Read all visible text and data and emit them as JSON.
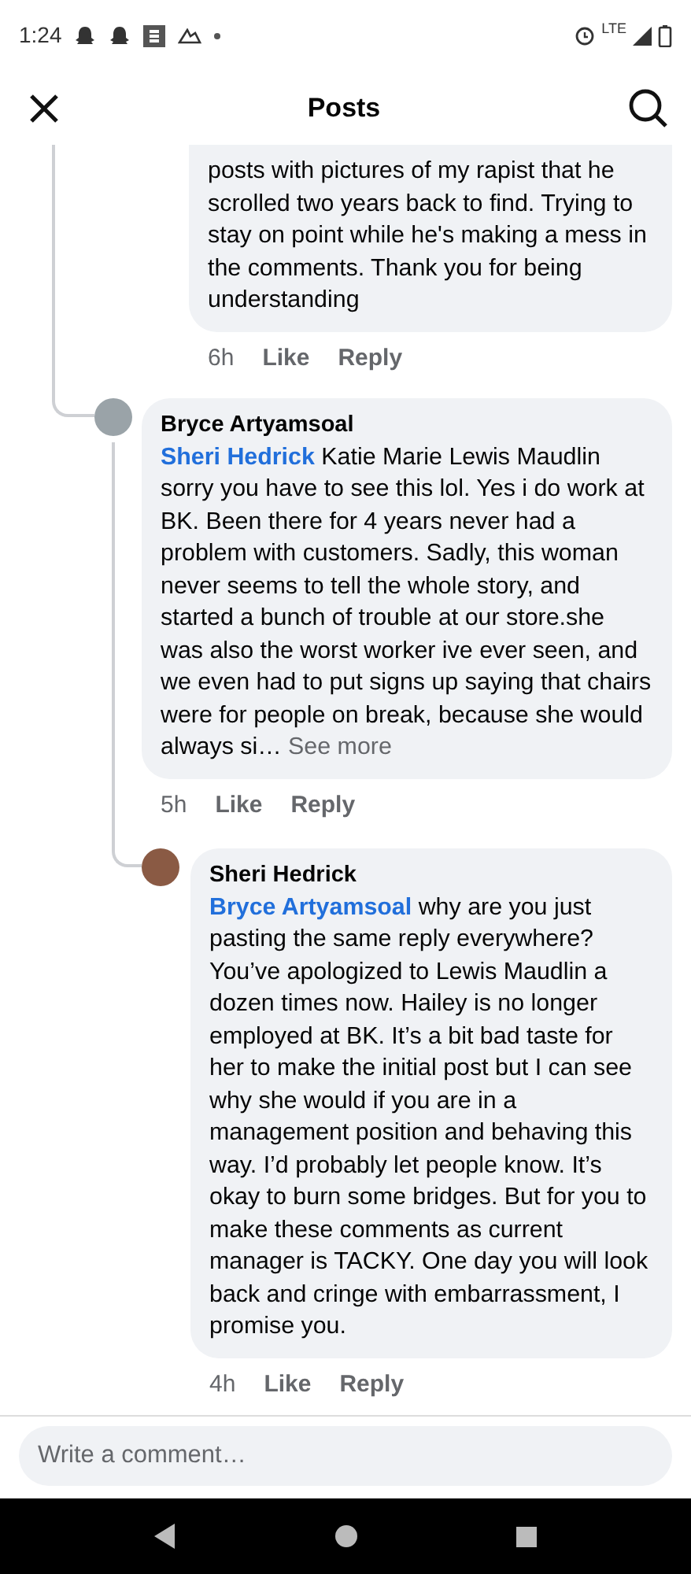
{
  "status_bar": {
    "time": "1:24",
    "network": "LTE"
  },
  "header": {
    "title": "Posts"
  },
  "comments": [
    {
      "text": "posts with pictures of my rapist that he scrolled two years back to find. Trying to stay on point while he's making a mess in the comments. Thank you for being understanding",
      "time": "6h",
      "like": "Like",
      "reply": "Reply"
    },
    {
      "author": "Bryce Artyamsoal",
      "mention": "Sheri Hedrick",
      "text": "Katie Marie Lewis Maudlin sorry you have to see this lol. Yes i do work at BK. Been there for 4 years never had a problem with customers. Sadly, this woman never seems to tell the whole story, and started a bunch of trouble at our store.she was also the worst worker ive ever seen, and we even had to put signs up saying that chairs were for people on break, because she would always si…",
      "see_more": "See more",
      "time": "5h",
      "like": "Like",
      "reply": "Reply",
      "children": [
        {
          "author": "Sheri Hedrick",
          "mention": "Bryce Artyamsoal",
          "text": "why are you just pasting the same reply everywhere? You’ve apologized to Lewis Maudlin a dozen times now. Hailey is no longer employed at BK. It’s a bit bad taste for her to make the initial post but I can see why she would if you are in a management position and behaving this way. I’d probably let people know. It’s okay to burn some bridges. But for you to make these comments as current manager is TACKY. One day you will look back and cringe with embarrassment, I promise you.",
          "time": "4h",
          "like": "Like",
          "reply": "Reply"
        }
      ]
    }
  ],
  "composer": {
    "placeholder": "Write a comment…"
  }
}
